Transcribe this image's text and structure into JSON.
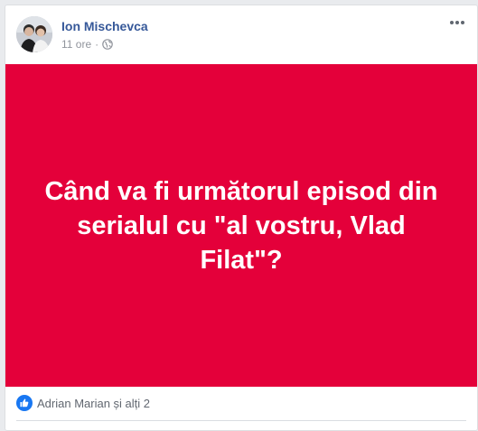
{
  "post": {
    "author": "Ion Mischevca",
    "time": "11 ore",
    "separator": "·",
    "privacy_icon": "globe-icon",
    "more_icon": "ellipsis-icon",
    "content_text": "Când va fi următorul episod din serialul cu \"al vostru, Vlad Filat\"?",
    "content_background": "#e4003a",
    "reactions_text": "Adrian Marian și alți 2",
    "reaction_icon": "like-icon"
  },
  "colors": {
    "author": "#365899",
    "meta": "#90949c",
    "like_blue": "#1877f2"
  }
}
